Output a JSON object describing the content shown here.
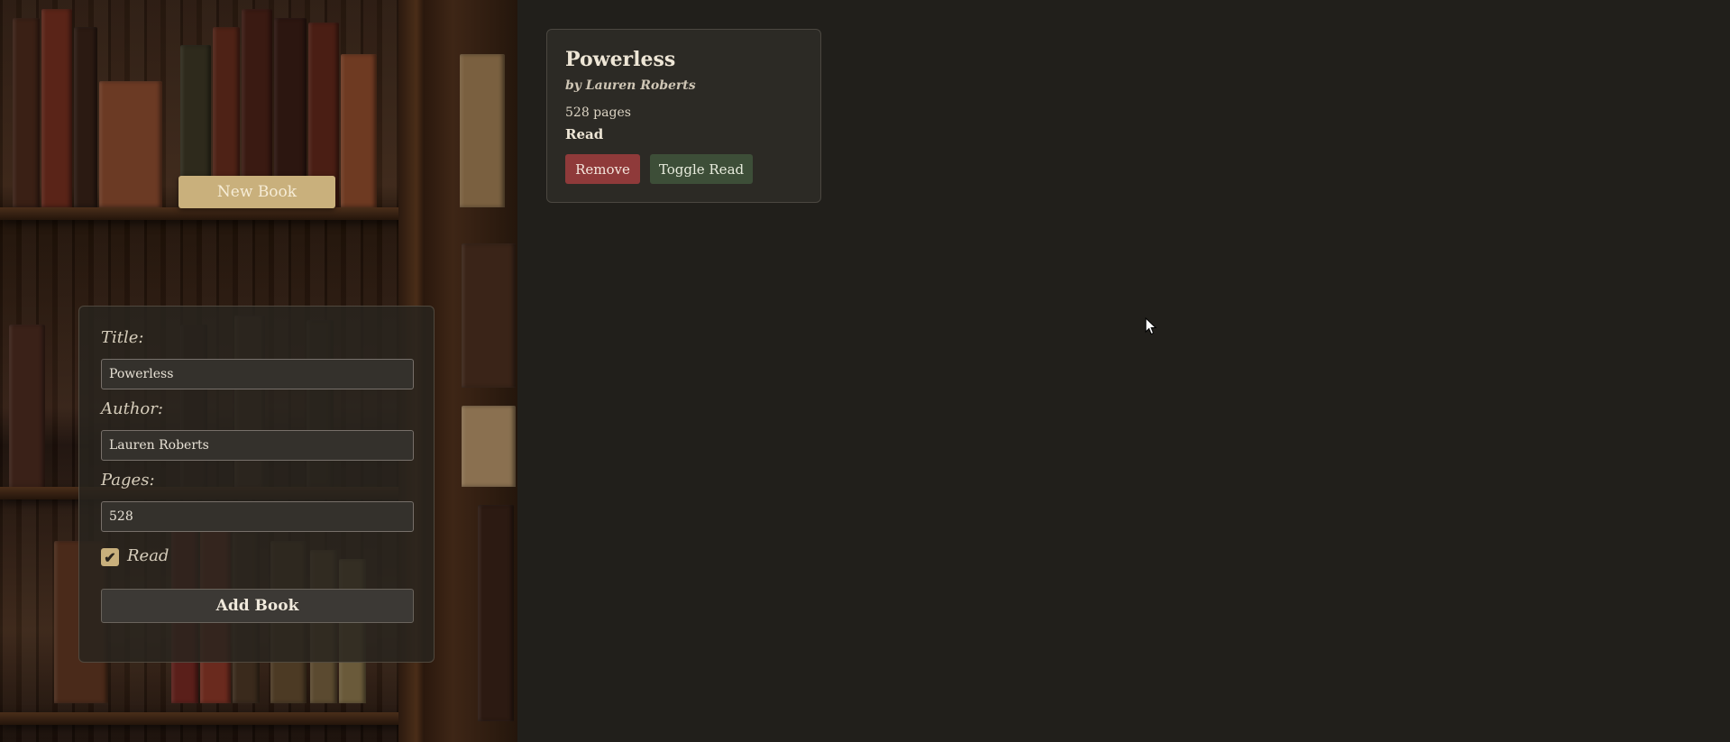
{
  "sidebar": {
    "new_book_label": "New Book"
  },
  "form": {
    "title_label": "Title:",
    "title_value": "Powerless",
    "author_label": "Author:",
    "author_value": "Lauren Roberts",
    "pages_label": "Pages:",
    "pages_value": "528",
    "read_label": "Read",
    "read_checked": true,
    "submit_label": "Add Book"
  },
  "library": {
    "books": [
      {
        "title": "Powerless",
        "author_line": "by Lauren Roberts",
        "pages_line": "528 pages",
        "status": "Read",
        "remove_label": "Remove",
        "toggle_label": "Toggle Read"
      }
    ]
  },
  "colors": {
    "accent": "#c9b07c",
    "remove": "#8f3a3a",
    "toggle": "#3d4e38",
    "background": "#211f1b"
  }
}
